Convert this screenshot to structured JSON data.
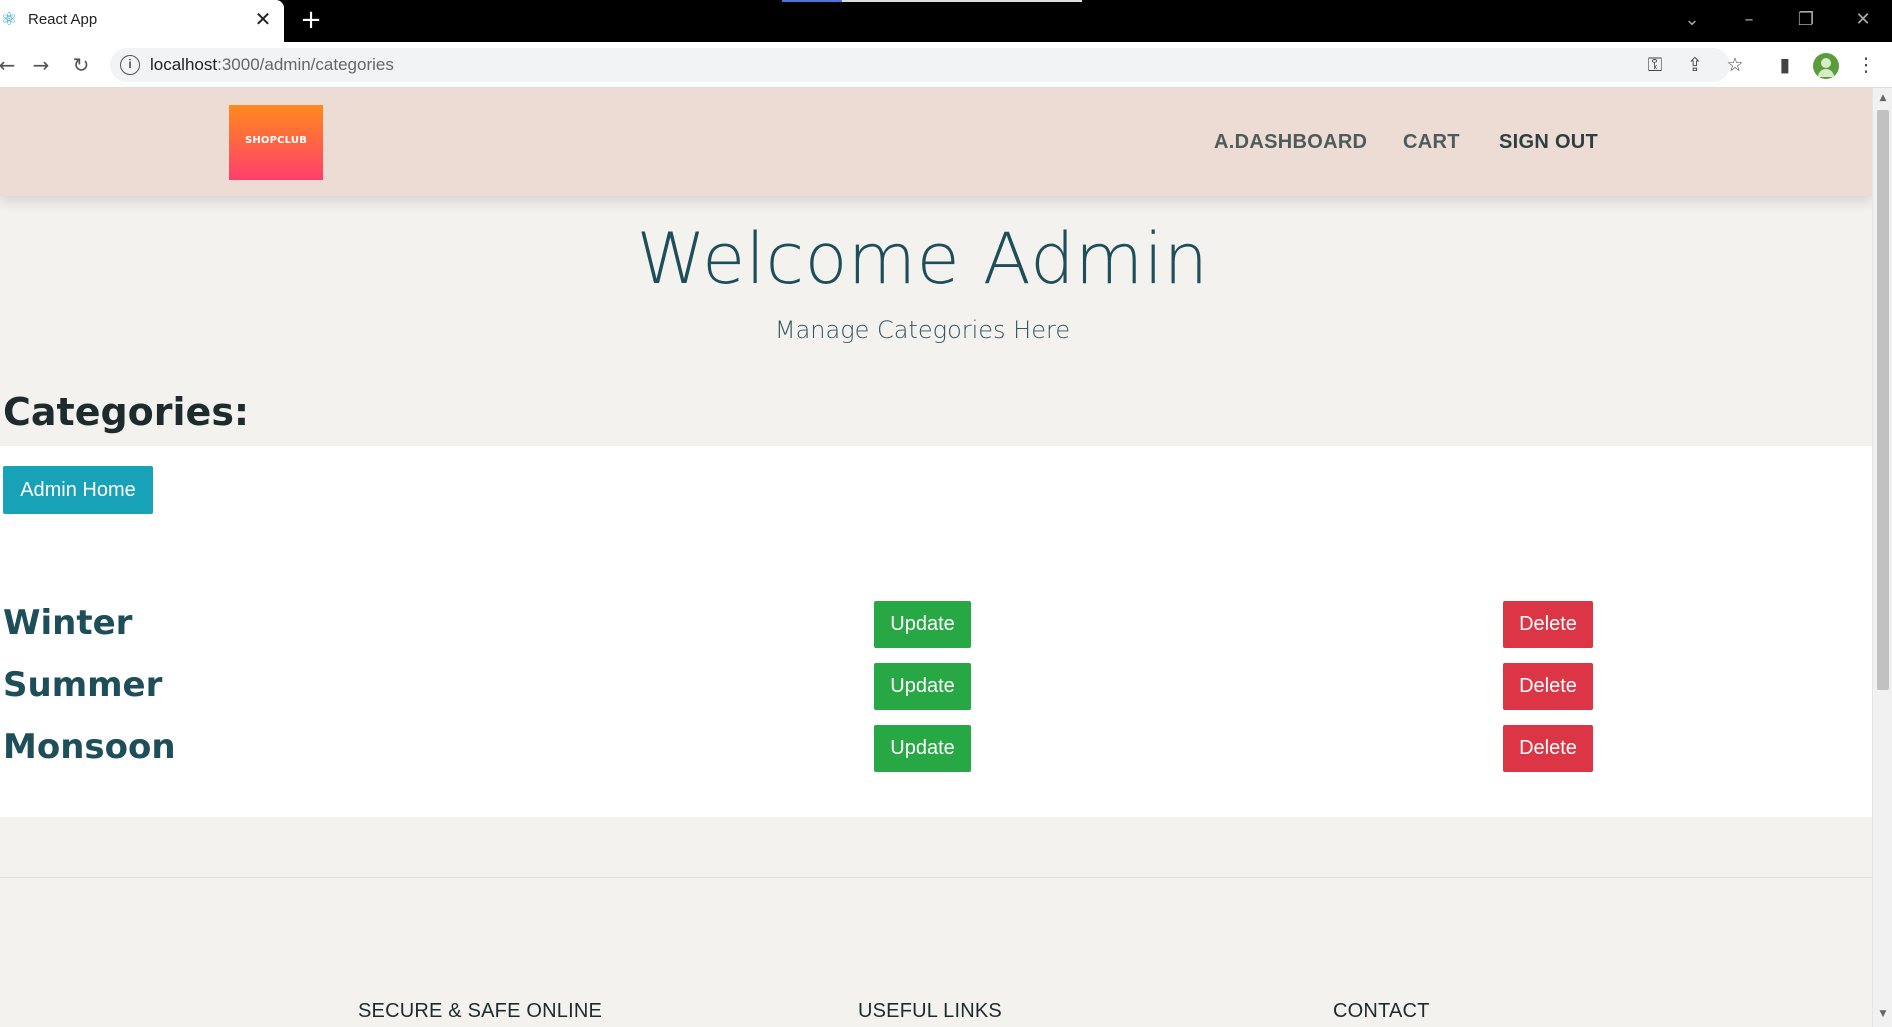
{
  "browser": {
    "tab_title": "React App",
    "tab_favicon": "react-icon",
    "url_host": "localhost",
    "url_rest": ":3000/admin/categories",
    "icons": [
      "back-icon",
      "forward-icon",
      "reload-icon",
      "info-icon",
      "key-icon",
      "share-icon",
      "star-icon",
      "side-panel-icon",
      "profile-avatar",
      "more-icon"
    ]
  },
  "navbar": {
    "logo_text": "SHOPCLUB",
    "links": [
      "A.DASHBOARD",
      "CART",
      "SIGN OUT"
    ]
  },
  "hero": {
    "title": "Welcome Admin",
    "subtitle": "Manage Categories Here"
  },
  "categories_section": {
    "title": "Categories:",
    "admin_home_label": "Admin Home",
    "items": [
      {
        "name": "Winter",
        "update_label": "Update",
        "delete_label": "Delete"
      },
      {
        "name": "Summer",
        "update_label": "Update",
        "delete_label": "Delete"
      },
      {
        "name": "Monsoon",
        "update_label": "Update",
        "delete_label": "Delete"
      }
    ]
  },
  "footer": {
    "headings": [
      "SECURE & SAFE ONLINE",
      "USEFUL LINKS",
      "CONTACT"
    ]
  },
  "colors": {
    "navbar_bg": "#ecdcd4",
    "hero_bg": "#f4f2ee",
    "info": "#17a2b8",
    "success": "#28a745",
    "danger": "#dc3545",
    "heading_teal": "#1d4e5a"
  }
}
